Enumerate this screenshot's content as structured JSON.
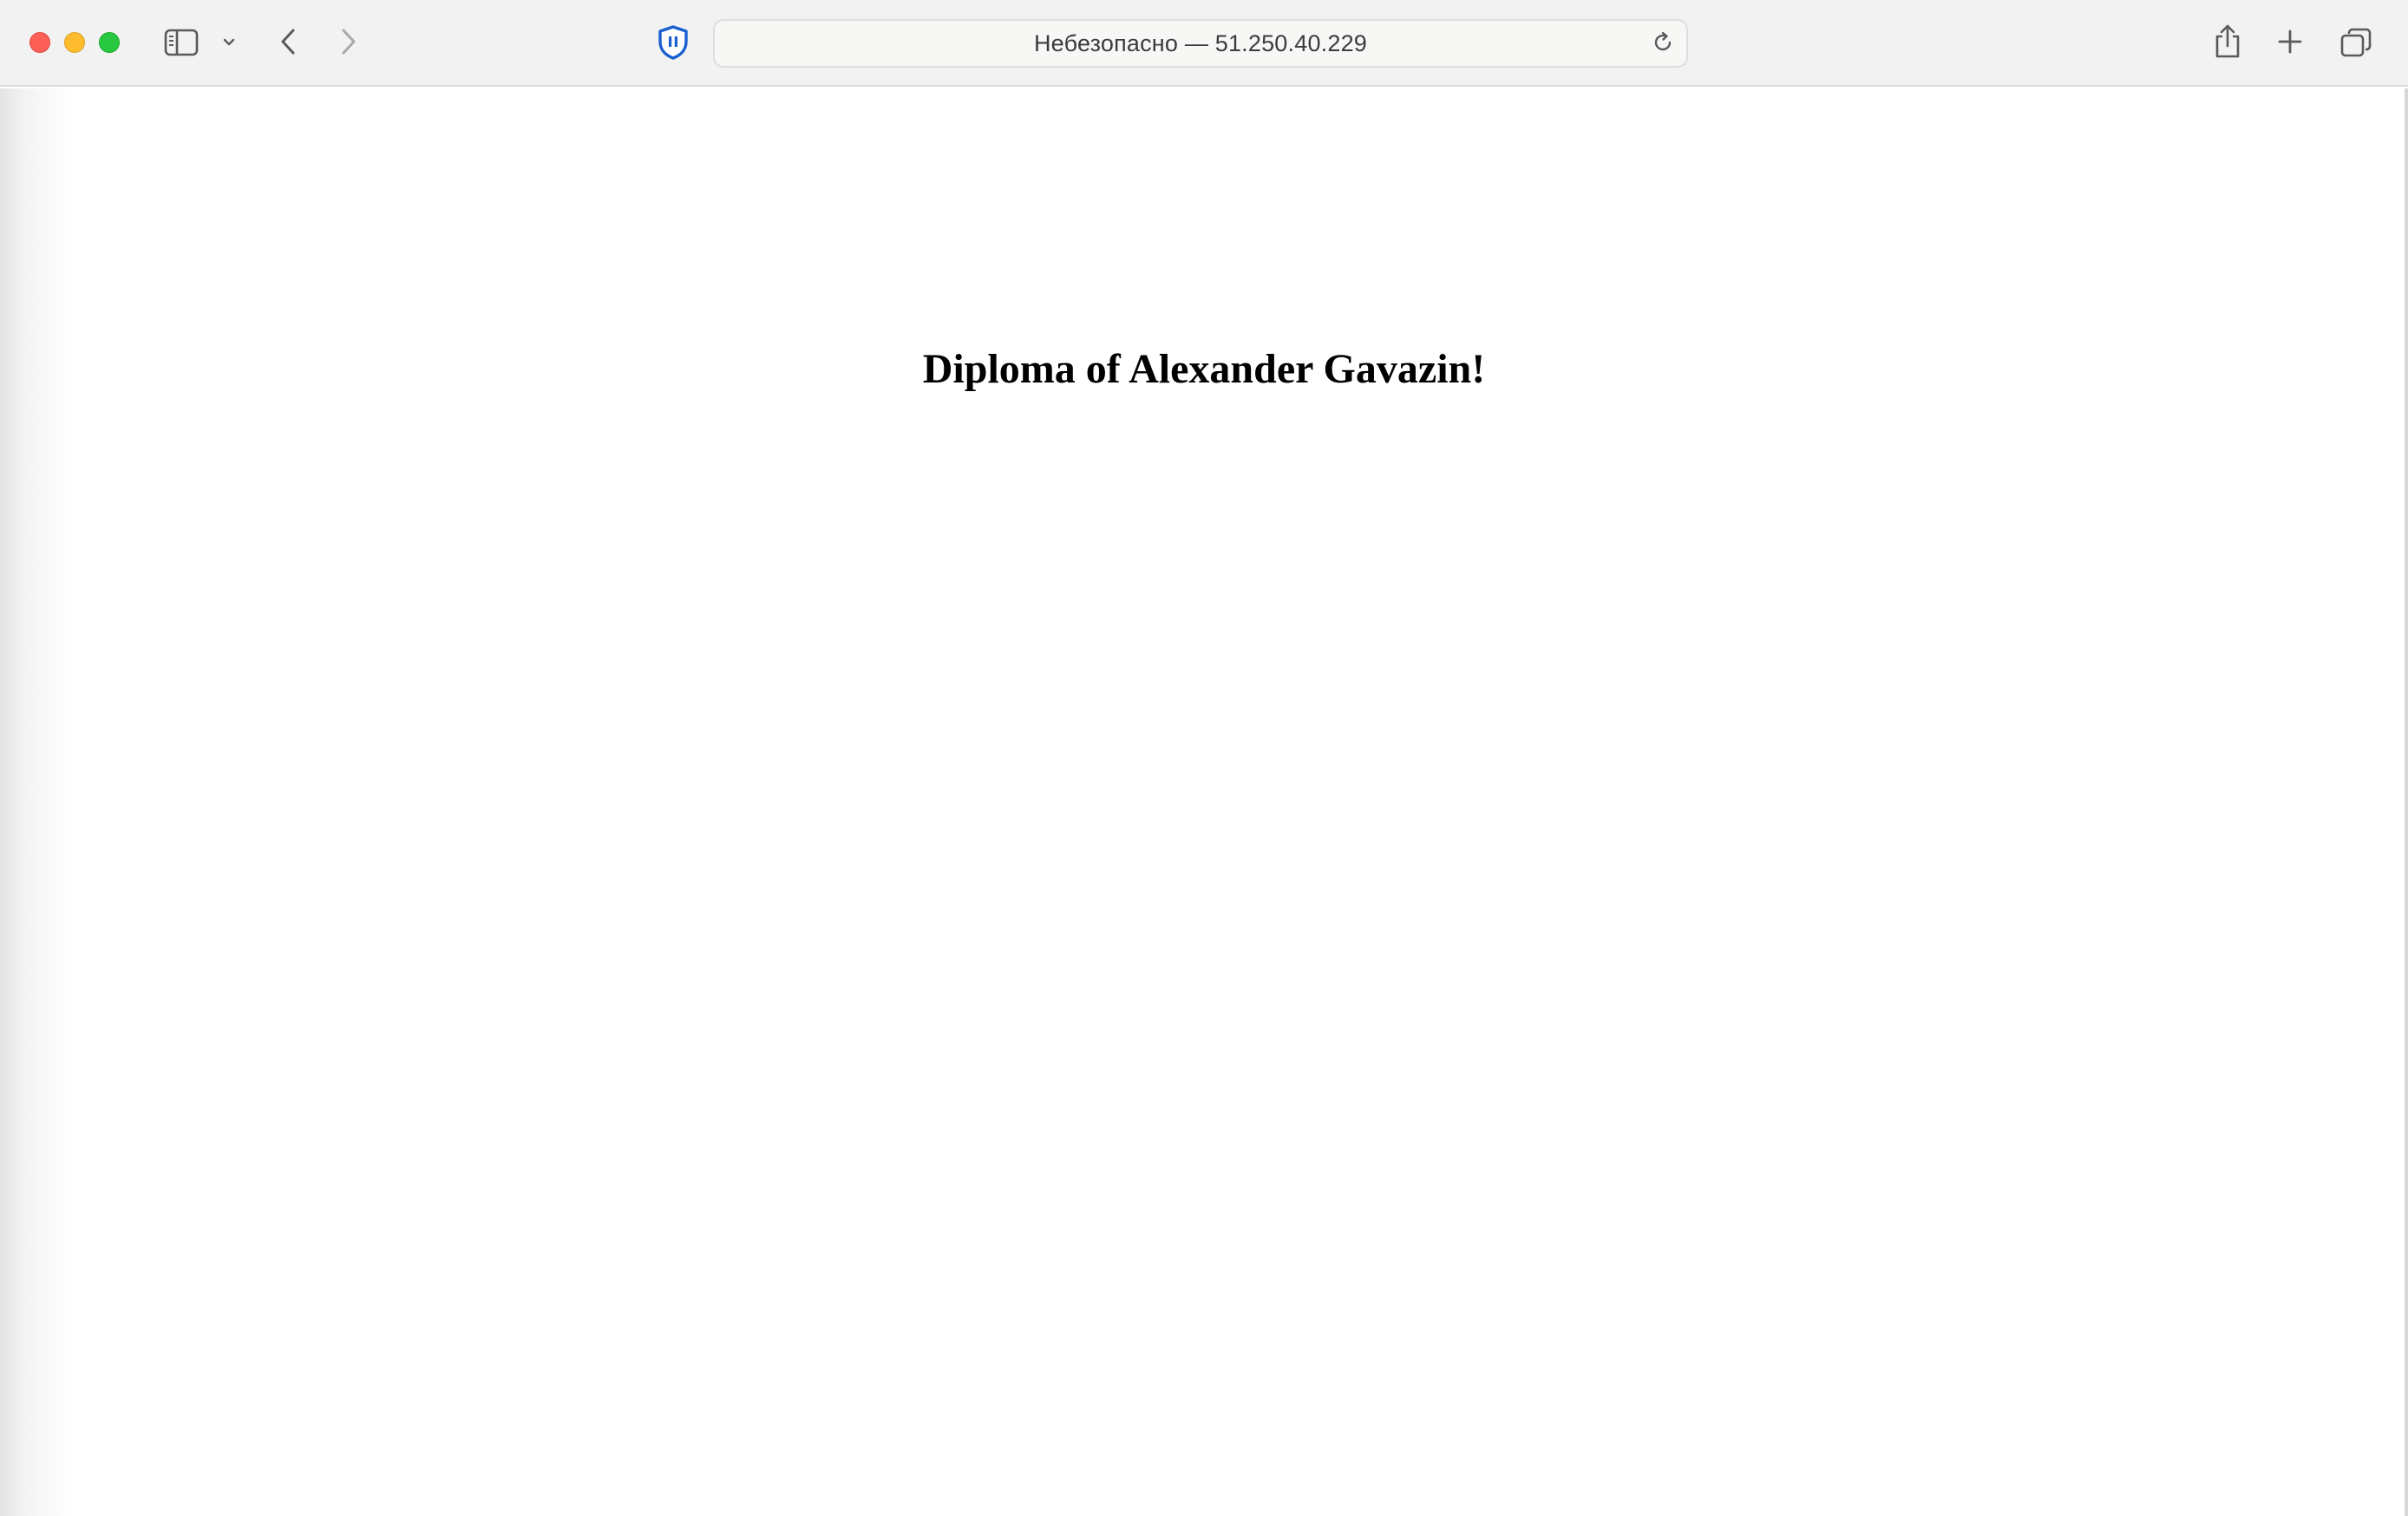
{
  "browser": {
    "address_bar": {
      "text": "Небезопасно — 51.250.40.229"
    },
    "toolbar_icons": [
      "sidebar-icon",
      "chevron-down-icon",
      "back-arrow-icon",
      "forward-arrow-icon",
      "shield-icon",
      "reload-icon",
      "share-icon",
      "plus-icon",
      "tabs-overview-icon"
    ],
    "colors": {
      "toolbar_bg": "#f1f2f1",
      "shield_accent": "#1a5fd0",
      "traffic_red": "#fe5f57",
      "traffic_yellow": "#febc2e",
      "traffic_green": "#28c840"
    }
  },
  "page": {
    "heading": "Diploma of Alexander Gavazin!"
  }
}
